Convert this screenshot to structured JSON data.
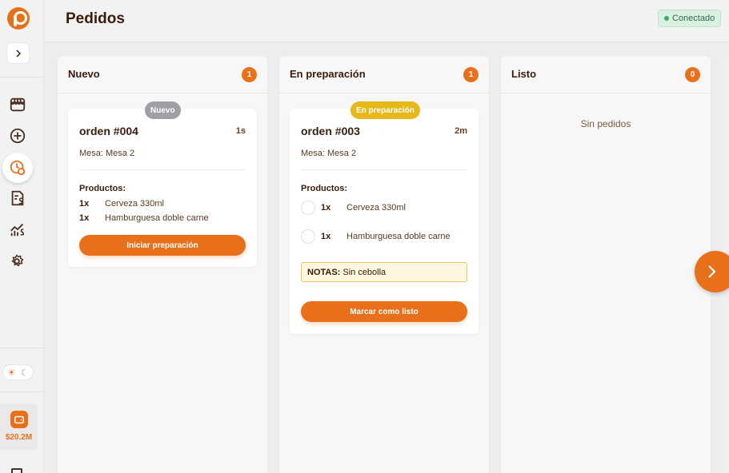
{
  "header": {
    "title": "Pedidos",
    "status_label": "Conectado"
  },
  "sidebar": {
    "icons": [
      "store-icon",
      "add-order-icon",
      "orders-clock-icon",
      "invoice-dollar-icon",
      "stats-dollar-icon",
      "settings-icon"
    ],
    "wallet_amount": "$20.2M"
  },
  "columns": [
    {
      "title": "Nuevo",
      "count": "1",
      "empty_text": "",
      "card": {
        "badge": "Nuevo",
        "order": "orden #004",
        "elapsed": "1s",
        "table": "Mesa: Mesa 2",
        "products_label": "Productos:",
        "items": [
          {
            "qty": "1x",
            "name": "Cerveza 330ml"
          },
          {
            "qty": "1x",
            "name": "Hamburguesa doble carne"
          }
        ],
        "action": "Iniciar preparación"
      }
    },
    {
      "title": "En preparación",
      "count": "1",
      "empty_text": "",
      "card": {
        "badge": "En preparación",
        "order": "orden #003",
        "elapsed": "2m",
        "table": "Mesa: Mesa 2",
        "products_label": "Productos:",
        "items": [
          {
            "qty": "1x",
            "name": "Cerveza 330ml"
          },
          {
            "qty": "1x",
            "name": "Hamburguesa doble carne"
          }
        ],
        "notes_label": "NOTAS:",
        "notes_text": "Sin cebolla",
        "action": "Marcar como listo"
      }
    },
    {
      "title": "Listo",
      "count": "0",
      "empty_text": "Sin pedidos"
    }
  ],
  "colors": {
    "accent": "#e8701a",
    "badge_new": "#9ea0a6",
    "badge_prep": "#e6b81a",
    "connected": "#3cab66"
  }
}
